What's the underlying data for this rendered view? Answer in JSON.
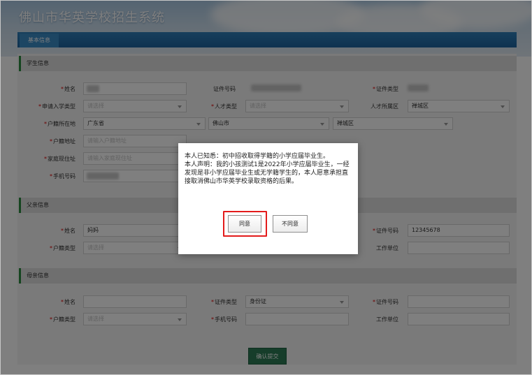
{
  "app": {
    "title": "佛山市华英学校招生系统"
  },
  "tabs": [
    {
      "label": "基本信息"
    }
  ],
  "student": {
    "section_title": "学生信息",
    "name": {
      "label": "姓名",
      "required": "*"
    },
    "id_number": {
      "label": "证件号码"
    },
    "id_type": {
      "label": "证件类型",
      "required": "*"
    },
    "apply_type": {
      "label": "申请入学类型",
      "required": "*",
      "placeholder": "请选择"
    },
    "talent_type": {
      "label": "人才类型",
      "required": "*",
      "placeholder": "请选择"
    },
    "talent_district": {
      "label": "人才所属区",
      "value": "禅城区"
    },
    "household": {
      "label": "户籍所在地",
      "required": "*",
      "province": "广东省",
      "city": "佛山市",
      "district": "禅城区"
    },
    "household_address": {
      "label": "户籍地址",
      "required": "*",
      "placeholder": "请输入户籍地址"
    },
    "home_address": {
      "label": "家庭现住址",
      "required": "*",
      "placeholder": "请输入家庭现住址"
    },
    "phone": {
      "label": "手机号码",
      "required": "*"
    }
  },
  "father": {
    "section_title": "父亲信息",
    "name": {
      "label": "姓名",
      "required": "*",
      "value": "妈妈"
    },
    "household_type": {
      "label": "户籍类型",
      "required": "*",
      "placeholder": "请选择"
    },
    "id_number": {
      "label": "证件号码",
      "required": "*",
      "value": "12345678"
    },
    "work_unit": {
      "label": "工作单位"
    }
  },
  "mother": {
    "section_title": "母亲信息",
    "name": {
      "label": "姓名",
      "required": "*"
    },
    "id_type": {
      "label": "证件类型",
      "required": "*",
      "value": "身份证"
    },
    "id_number": {
      "label": "证件号码",
      "required": "*"
    },
    "household_type": {
      "label": "户籍类型",
      "required": "*",
      "placeholder": "请选择"
    },
    "phone": {
      "label": "手机号码",
      "required": "*"
    },
    "work_unit": {
      "label": "工作单位"
    }
  },
  "submit_label": "确认提交",
  "modal": {
    "line1": "本人已知悉：初中招收取得学籍的小学应届毕业生。",
    "line2": "本人声明：我的小孩测试1是2022年小学应届毕业生，一经发现是非小学应届毕业生或无学籍学生的，本人愿意承担直接取消佛山市华英学校录取资格的后果。",
    "agree_label": "同意",
    "disagree_label": "不同意"
  },
  "colors": {
    "primary_blue": "#1d64a0",
    "submit_green": "#2d7b55",
    "highlight_red": "#e31b1b",
    "required_red": "#dd0000"
  }
}
